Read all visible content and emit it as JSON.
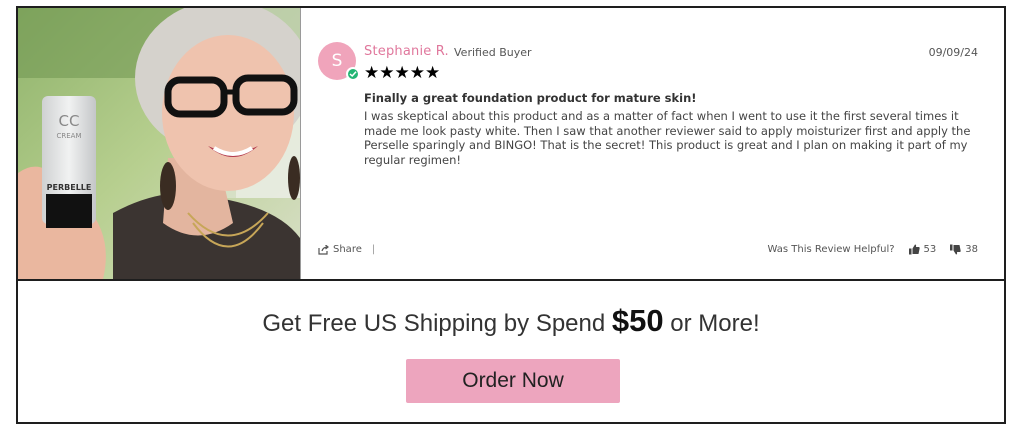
{
  "review": {
    "avatar_initial": "S",
    "reviewer_name": "Stephanie R.",
    "verified_label": "Verified Buyer",
    "date": "09/09/24",
    "rating": 5,
    "stars": "★★★★★",
    "title": "Finally a great foundation product for mature skin!",
    "body": "I was skeptical about this product and as a matter of fact when I went to use it the first several times it made me look pasty white. Then I saw that another reviewer said to apply moisturizer first and apply the Perselle sparingly and BINGO! That is the secret! This product is great and I plan on making it part of my regular regimen!",
    "share_label": "Share",
    "share_separator": "|",
    "helpful_label": "Was This Review Helpful?",
    "upvotes": "53",
    "downvotes": "38",
    "product_label": {
      "line1": "CC",
      "line2": "CREAM",
      "brand": "PERBELLE"
    }
  },
  "promo": {
    "text_before": "Get Free US Shipping by Spend",
    "amount": "$50",
    "text_after": "or More!",
    "button_label": "Order Now"
  },
  "colors": {
    "accent_pink": "#eda5be",
    "name_pink": "#e0779c",
    "avatar_pink": "#f0a4bb",
    "verified_green": "#22b573",
    "border": "#1e1e1e"
  }
}
